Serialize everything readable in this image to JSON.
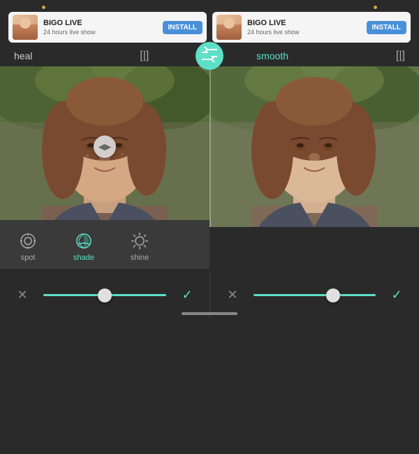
{
  "dots": [
    "dot1",
    "dot2"
  ],
  "ads": [
    {
      "title": "BIGO LIVE",
      "subtitle": "24 hours live show",
      "install_label": "INSTALL"
    },
    {
      "title": "BIGO LIVE",
      "subtitle": "24 hours live show",
      "install_label": "INSTALL"
    }
  ],
  "filters": {
    "left_label": "heal",
    "right_label": "smooth",
    "swap_icon": "⇄"
  },
  "tools": [
    {
      "id": "spot",
      "label": "spot",
      "active": false
    },
    {
      "id": "shade",
      "label": "shade",
      "active": true
    },
    {
      "id": "shine",
      "label": "shine",
      "active": false
    }
  ],
  "action_bars": [
    {
      "cancel": "✕",
      "confirm": "✓"
    },
    {
      "cancel": "✕",
      "confirm": "✓"
    }
  ],
  "colors": {
    "accent": "#5de0c8",
    "bg_dark": "#2a2a2a",
    "bg_panel": "#3a3a3a"
  }
}
